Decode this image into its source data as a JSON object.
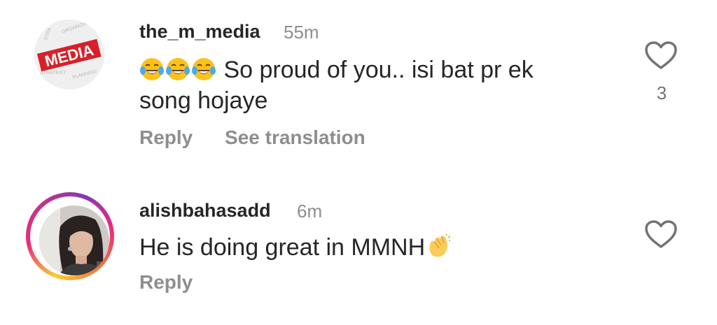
{
  "comments": [
    {
      "username": "the_m_media",
      "time": "55m",
      "text": "So proud of you.. isi bat pr ek song hojaye",
      "emoji_prefix": [
        "joy-emoji",
        "joy-emoji",
        "joy-emoji"
      ],
      "reply_label": "Reply",
      "translate_label": "See translation",
      "like_icon": "heart-outline-icon",
      "like_count": "3",
      "avatar_logo_text": "MEDIA"
    },
    {
      "username": "alishbahasadd",
      "time": "6m",
      "text": "He is doing great in MMNH",
      "emoji_suffix": "clapping-hands-emoji",
      "reply_label": "Reply",
      "like_icon": "heart-outline-icon",
      "has_story_ring": true
    }
  ],
  "colors": {
    "text": "#262626",
    "secondary": "#8e8e8e",
    "media_red": "#d8202a",
    "story_ring": [
      "#f9ce34",
      "#ee2a7b",
      "#833ab4"
    ]
  }
}
